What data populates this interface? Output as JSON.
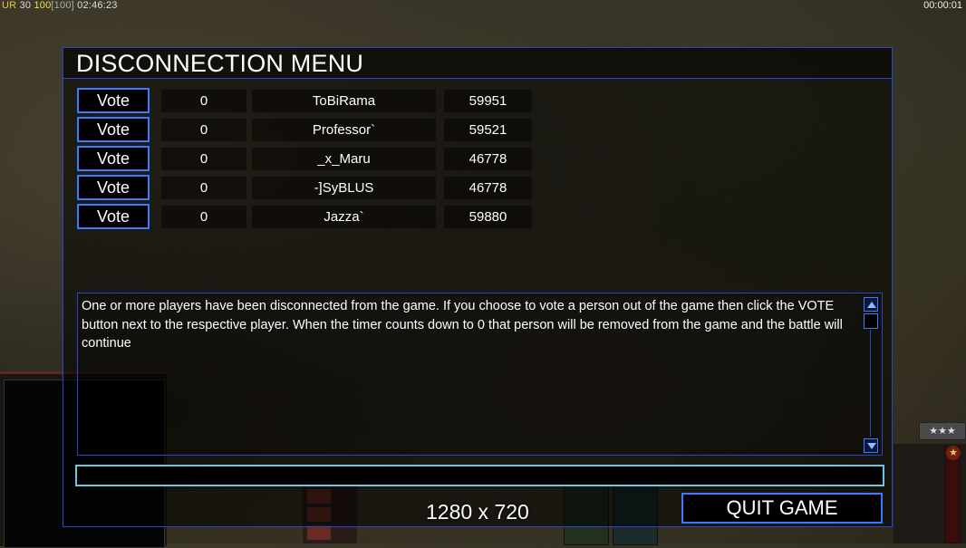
{
  "hud": {
    "rank": "UR",
    "level": "30",
    "power": "100",
    "power_cap": "[100]",
    "game_time": "02:46:23",
    "timer": "00:00:01"
  },
  "dialog": {
    "title": "DISCONNECTION MENU",
    "vote_label": "Vote",
    "players": [
      {
        "votes": "0",
        "name": "ToBiRama",
        "ping": "59951"
      },
      {
        "votes": "0",
        "name": "Professor`",
        "ping": "59521"
      },
      {
        "votes": "0",
        "name": "_x_Maru",
        "ping": "46778"
      },
      {
        "votes": "0",
        "name": "-]SyBLUS",
        "ping": "46778"
      },
      {
        "votes": "0",
        "name": "Jazza`",
        "ping": "59880"
      }
    ],
    "message": "One or more players have been disconnected from the game. If you choose to vote a person out of the game then click the VOTE button next to the respective player. When the timer counts down to 0 that person will be removed from the game and the battle will continue",
    "chat_value": "",
    "quit_label": "QUIT GAME"
  },
  "overlay": {
    "resolution": "1280 x 720"
  },
  "sidebar": {
    "rank_stars": "★★★",
    "medal": "★"
  }
}
